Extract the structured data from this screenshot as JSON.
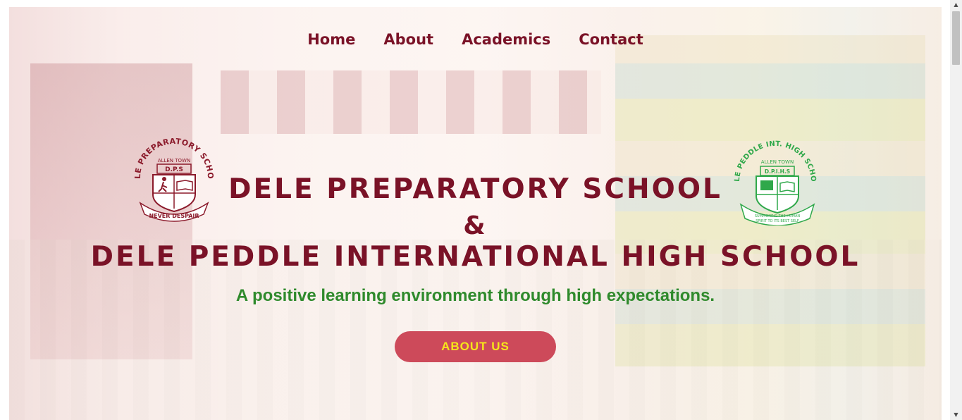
{
  "nav": {
    "items": [
      {
        "label": "Home"
      },
      {
        "label": "About"
      },
      {
        "label": "Academics"
      },
      {
        "label": "Contact"
      }
    ]
  },
  "hero": {
    "title_line1": "DELE PREPARATORY SCHOOL",
    "title_amp": "&",
    "title_line2": "DELE PEDDLE INTERNATIONAL HIGH SCHOOL",
    "tagline": "A positive learning environment through high expectations.",
    "button_label": "ABOUT US"
  },
  "logo_left": {
    "arc_text": "DELE PREPARATORY SCHOOL",
    "town": "ALLEN TOWN",
    "initials": "D.P.S",
    "motto": "NEVER DESPAIR",
    "color": "#8b1a2b"
  },
  "logo_right": {
    "arc_text": "DELE PEDDLE INT. HIGH SCHOOL",
    "town": "ALLEN TOWN",
    "initials": "D.P.I.H.S",
    "motto_line1": "SUMMONING THE HUMAN",
    "motto_line2": "SPIRIT TO ITS BEST SELF",
    "color": "#2fa84a"
  },
  "colors": {
    "primary": "#7a1227",
    "tagline": "#2f8a2c",
    "button_bg": "#cd4a5a",
    "button_text": "#f6e51a"
  }
}
